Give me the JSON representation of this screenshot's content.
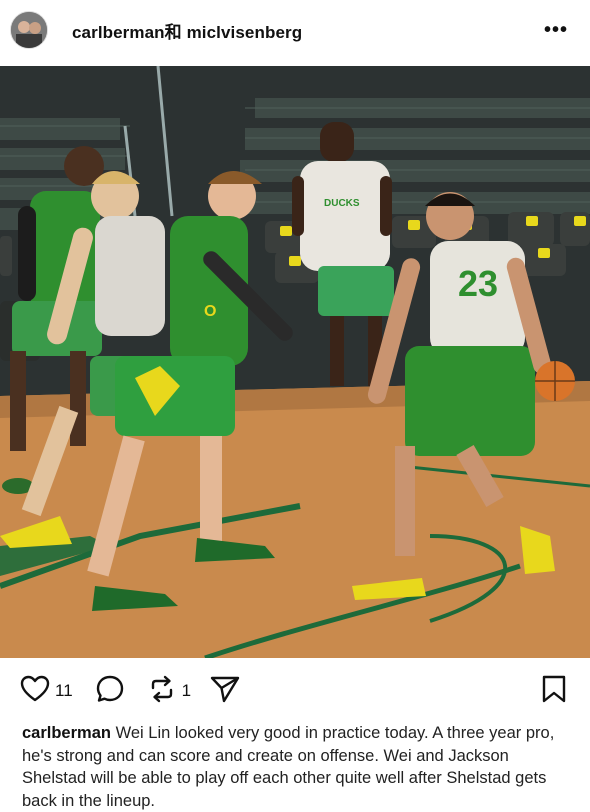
{
  "post": {
    "author": "carlberman",
    "header_title": "carlberman和 miclvisenberg",
    "more_label": "•••",
    "likes": "11",
    "reposts": "1",
    "caption": "Wei Lin looked very good in practice today. A three year pro, he's strong and can score and create on offense. Wei and Jackson Shelstad will be able to play off each other quite well after Shelstad gets back in the lineup."
  },
  "photo": {
    "jersey_number": "23",
    "shirt_text": "DUCKS"
  },
  "icons": {
    "like": "heart-icon",
    "comment": "comment-icon",
    "repost": "repost-icon",
    "share": "send-icon",
    "save": "bookmark-icon",
    "more": "more-icon"
  },
  "colors": {
    "green_jersey": "#2f8f2f",
    "court": "#c98a4d",
    "seat": "#3b3f3c",
    "logo_yellow": "#e8d81c"
  }
}
